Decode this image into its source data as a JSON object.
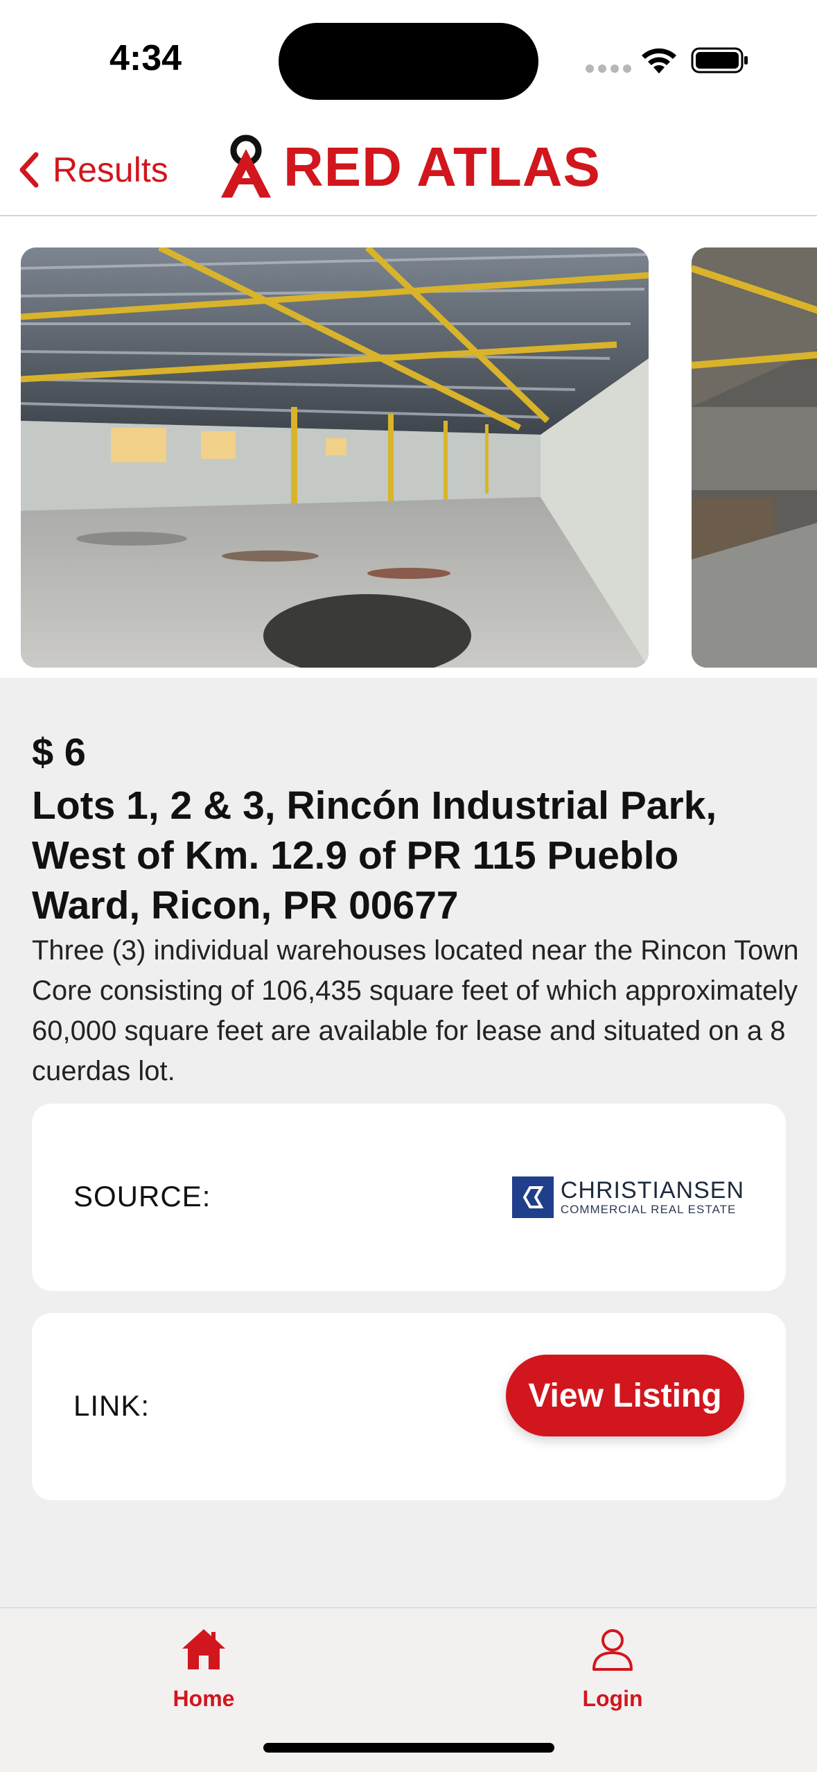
{
  "status_bar": {
    "time": "4:34"
  },
  "header": {
    "back_label": "Results",
    "logo_text": "RED ATLAS",
    "brand_color": "#d1161d"
  },
  "gallery": {
    "photos": [
      {
        "alt": "warehouse-interior-photo"
      },
      {
        "alt": "warehouse-interior-photo-partial"
      }
    ]
  },
  "listing": {
    "price": "$ 6",
    "address": "Lots 1, 2 & 3, Rincón Industrial Park, West of Km. 12.9 of PR 115 Pueblo Ward, Ricon, PR  00677",
    "description": "Three (3) individual warehouses located near the Rincon Town Core consisting of 106,435 square feet of which approximately 60,000 square feet are available for lease and situated on a 8 cuerdas lot."
  },
  "source_card": {
    "label": "SOURCE:",
    "logo_name": "CHRISTIANSEN",
    "logo_sub": "COMMERCIAL REAL ESTATE"
  },
  "link_card": {
    "label": "LINK:",
    "button_label": "View Listing"
  },
  "tab_bar": {
    "tabs": [
      {
        "label": "Home",
        "icon": "home-icon"
      },
      {
        "label": "Login",
        "icon": "person-icon"
      }
    ]
  }
}
